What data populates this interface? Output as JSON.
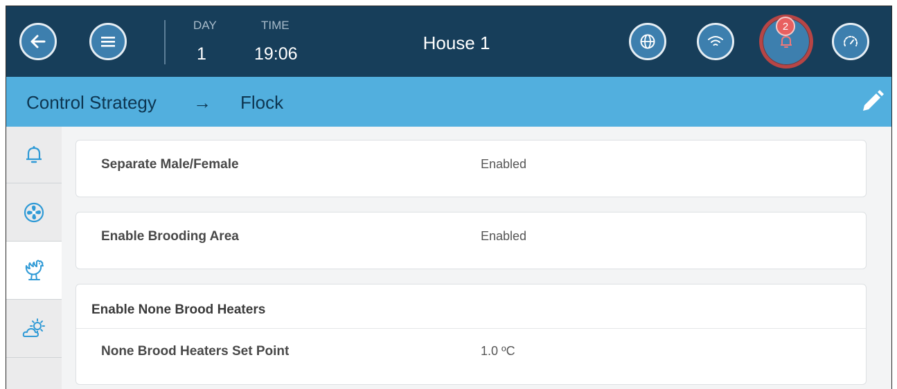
{
  "topbar": {
    "day_label": "DAY",
    "day_value": "1",
    "time_label": "TIME",
    "time_value": "19:06",
    "house_title": "House 1",
    "alarm_count": "2",
    "icons": [
      "back-icon",
      "menu-icon",
      "globe-icon",
      "wifi-icon",
      "bell-icon",
      "gauge-icon"
    ]
  },
  "breadcrumb": {
    "parent": "Control Strategy",
    "separator": "→",
    "current": "Flock",
    "edit_icon": "pencil-icon"
  },
  "sidebar": {
    "items": [
      {
        "icon": "bell-icon",
        "active": false
      },
      {
        "icon": "fan-icon",
        "active": false
      },
      {
        "icon": "rooster-icon",
        "active": true
      },
      {
        "icon": "weather-icon",
        "active": false
      }
    ]
  },
  "settings": {
    "separate_male_female": {
      "label": "Separate Male/Female",
      "value": "Enabled"
    },
    "enable_brooding_area": {
      "label": "Enable Brooding Area",
      "value": "Enabled"
    },
    "none_brood_heaters": {
      "header": "Enable None Brood Heaters",
      "set_point": {
        "label": "None Brood Heaters Set Point",
        "value": "1.0 ºC"
      }
    }
  },
  "colors": {
    "topbar": "#173e5a",
    "button": "#3d7fae",
    "crumbbar": "#52afde",
    "alarm_ring": "#b84545",
    "badge": "#e86060",
    "sidebar_icon": "#2f9ad6"
  }
}
